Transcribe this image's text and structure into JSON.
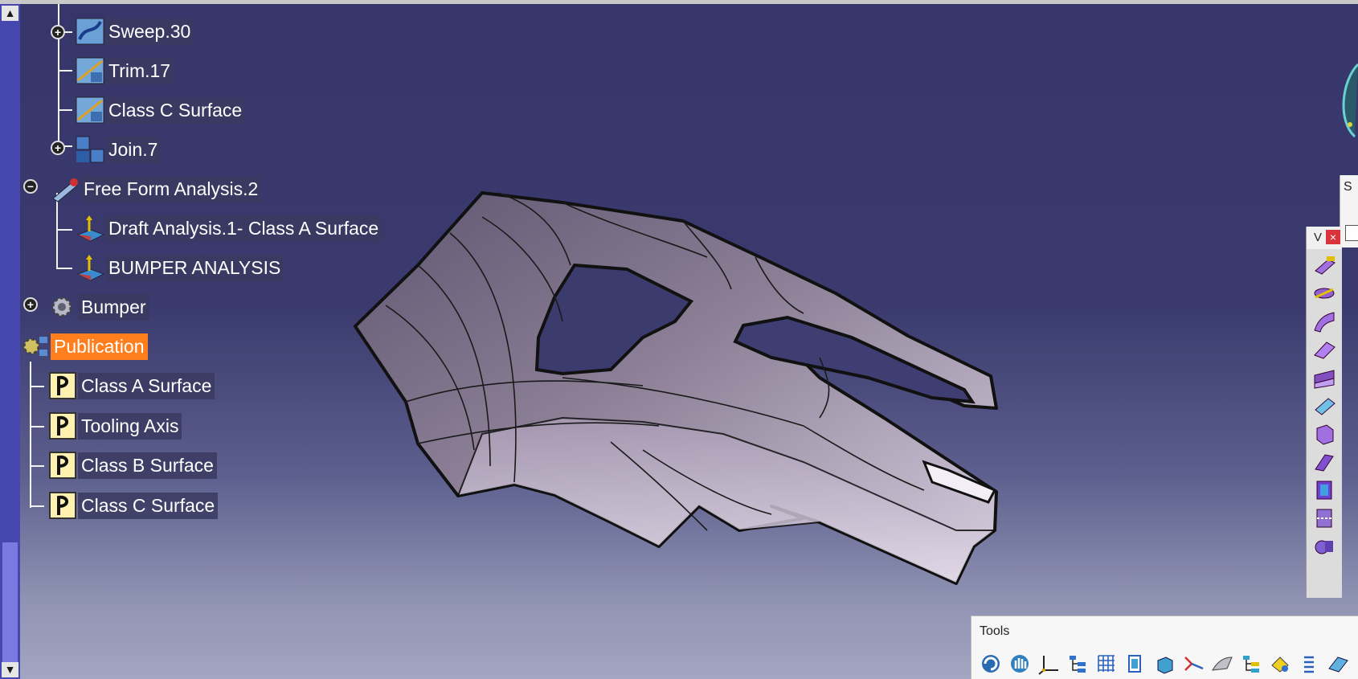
{
  "tree": {
    "nodes": [
      {
        "label": "Sweep.30"
      },
      {
        "label": "Trim.17"
      },
      {
        "label": "Class C Surface"
      },
      {
        "label": "Join.7"
      },
      {
        "label": "Free Form Analysis.2"
      },
      {
        "label": "Draft Analysis.1- Class A Surface"
      },
      {
        "label": "BUMPER ANALYSIS"
      },
      {
        "label": "Bumper"
      },
      {
        "label": "Publication"
      },
      {
        "label": "Class A Surface"
      },
      {
        "label": "Tooling Axis"
      },
      {
        "label": "Class B Surface"
      },
      {
        "label": "Class C Surface"
      }
    ],
    "selected": "Publication"
  },
  "scrollbar": {
    "up_glyph": "▲",
    "down_glyph": "▼"
  },
  "right_toolbar": {
    "title": "V",
    "close_glyph": "×"
  },
  "mini_panel": {
    "label": "S"
  },
  "tools_toolbar": {
    "title": "Tools"
  },
  "colors": {
    "selection": "#ff7e1d",
    "part_surface": "#bfb2c9",
    "background_top": "#37366a",
    "background_bottom": "#a3a6c0"
  }
}
